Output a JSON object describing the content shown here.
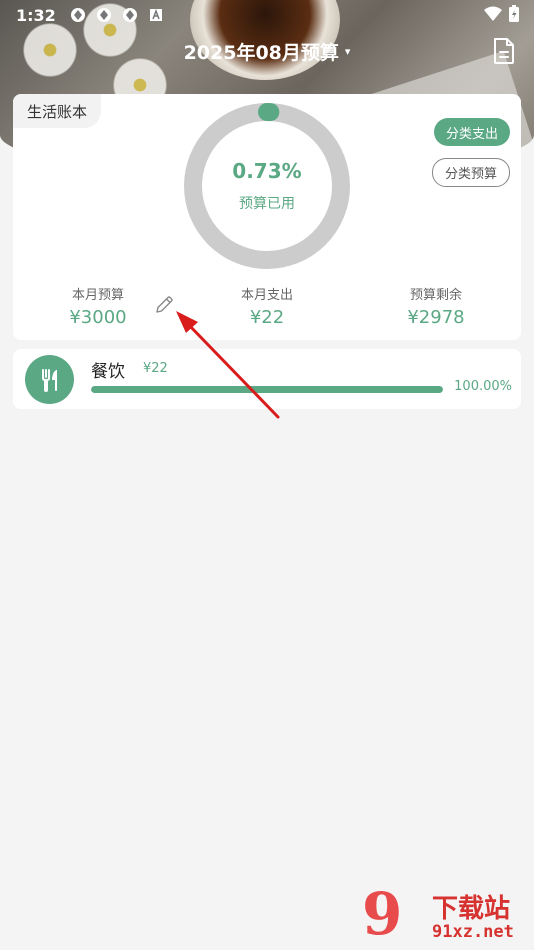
{
  "status_bar": {
    "time": "1:32"
  },
  "header": {
    "title": "2025年08月预算",
    "caret": "▾"
  },
  "budget_card": {
    "book_name": "生活账本",
    "used_percent": "0.73%",
    "used_fraction": 0.0073,
    "used_label": "预算已用",
    "buttons": {
      "category_spending": "分类支出",
      "category_budget": "分类预算"
    },
    "stats": {
      "monthly_budget_label": "本月预算",
      "monthly_budget_value": "¥3000",
      "monthly_spending_label": "本月支出",
      "monthly_spending_value": "¥22",
      "remaining_label": "预算剩余",
      "remaining_value": "¥2978"
    }
  },
  "categories": [
    {
      "name": "餐饮",
      "amount": "¥22",
      "percent": "100.00%",
      "fraction": 1.0,
      "icon": "fork-knife-icon"
    }
  ],
  "watermark": {
    "logo": "9",
    "text": "下载站",
    "url": "91xz.net"
  },
  "colors": {
    "accent": "#5ba884",
    "ring_track": "#cccccc",
    "arrow": "#d91c1c",
    "background": "#f4f4f4"
  }
}
